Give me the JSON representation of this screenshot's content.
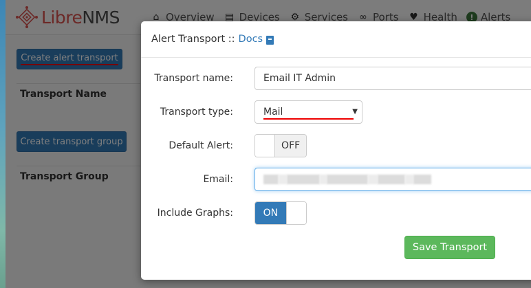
{
  "brand": {
    "name_part1": "Libre",
    "name_part2": "NMS"
  },
  "nav": [
    {
      "label": "Overview",
      "icon": "home-icon"
    },
    {
      "label": "Devices",
      "icon": "server-icon"
    },
    {
      "label": "Services",
      "icon": "cogs-icon"
    },
    {
      "label": "Ports",
      "icon": "link-icon"
    },
    {
      "label": "Health",
      "icon": "heartbeat-icon"
    },
    {
      "label": "Alerts",
      "icon": "exclamation-circle-icon"
    }
  ],
  "page": {
    "create_transport_button": "Create alert transport",
    "transport_name_header": "Transport Name",
    "create_group_button": "Create transport group",
    "transport_group_header": "Transport Group"
  },
  "modal": {
    "title": "Alert Transport ::",
    "docs_link": "Docs",
    "docs_icon": "book-icon",
    "fields": {
      "transport_name_label": "Transport name:",
      "transport_name_value": "Email IT Admin",
      "transport_type_label": "Transport type:",
      "transport_type_value": "Mail",
      "default_alert_label": "Default Alert:",
      "default_alert_state": "OFF",
      "email_label": "Email:",
      "include_graphs_label": "Include Graphs:",
      "include_graphs_state": "ON"
    },
    "save_button": "Save Transport"
  },
  "colors": {
    "primary": "#337ab7",
    "success": "#5cb85c",
    "brand_red": "#d9534f",
    "annotation_red": "#e00000"
  }
}
